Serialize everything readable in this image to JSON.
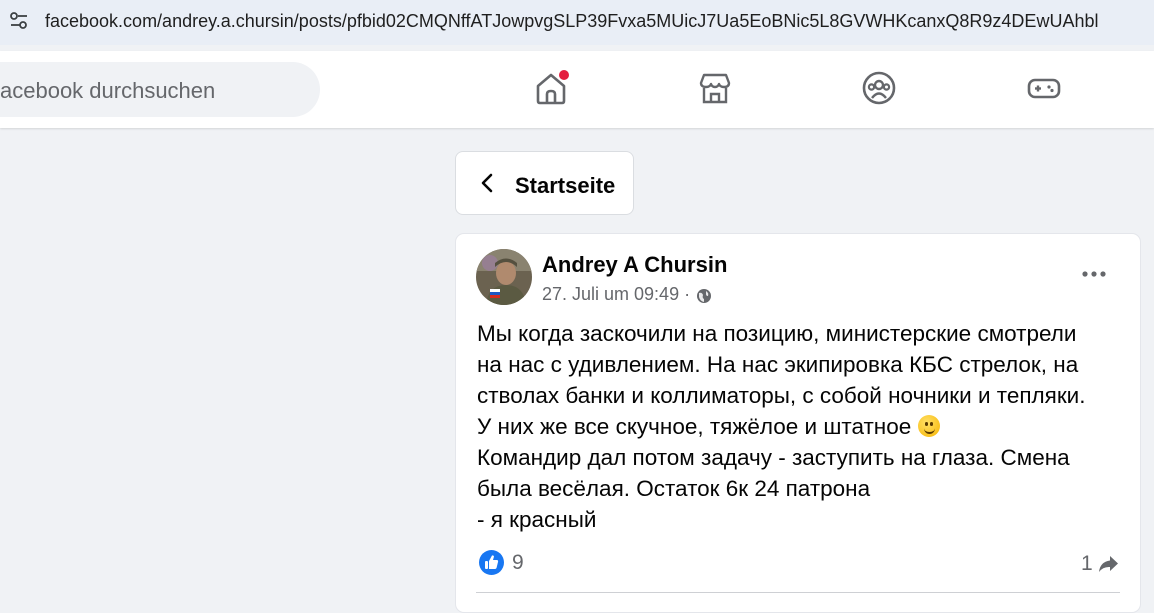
{
  "browser": {
    "url": "facebook.com/andrey.a.chursin/posts/pfbid02CMQNffATJowpvgSLP39Fvxa5MUicJ7Ua5EoBNic5L8GVWHKcanxQ8R9z4DEwUAhbl"
  },
  "topnav": {
    "search_placeholder": "acebook durchsuchen",
    "icons": [
      "home-icon",
      "marketplace-icon",
      "groups-icon",
      "gaming-icon"
    ],
    "home_has_notification": true
  },
  "back": {
    "label": "Startseite"
  },
  "post": {
    "author": "Andrey A Chursin",
    "timestamp": "27. Juli um 09:49",
    "separator": "·",
    "audience_icon": "globe-icon",
    "lines": [
      "Мы когда заскочили на позицию, министерские смотрели",
      "на нас с удивлением. На нас экипировка КБС стрелок, на",
      "стволах банки и коллиматоры, с собой ночники и тепляки.",
      "У них же все скучное, тяжёлое и штатное",
      "Командир дал потом задачу - заступить на глаза. Смена",
      "была весёлая. Остаток 6к 24 патрона",
      "- я красный"
    ],
    "reactions": {
      "like_count": "9"
    },
    "shares": {
      "count": "1"
    }
  },
  "colors": {
    "brand_blue": "#1877f2",
    "notification_red": "#e41e3f",
    "secondary_text": "#65676b"
  }
}
